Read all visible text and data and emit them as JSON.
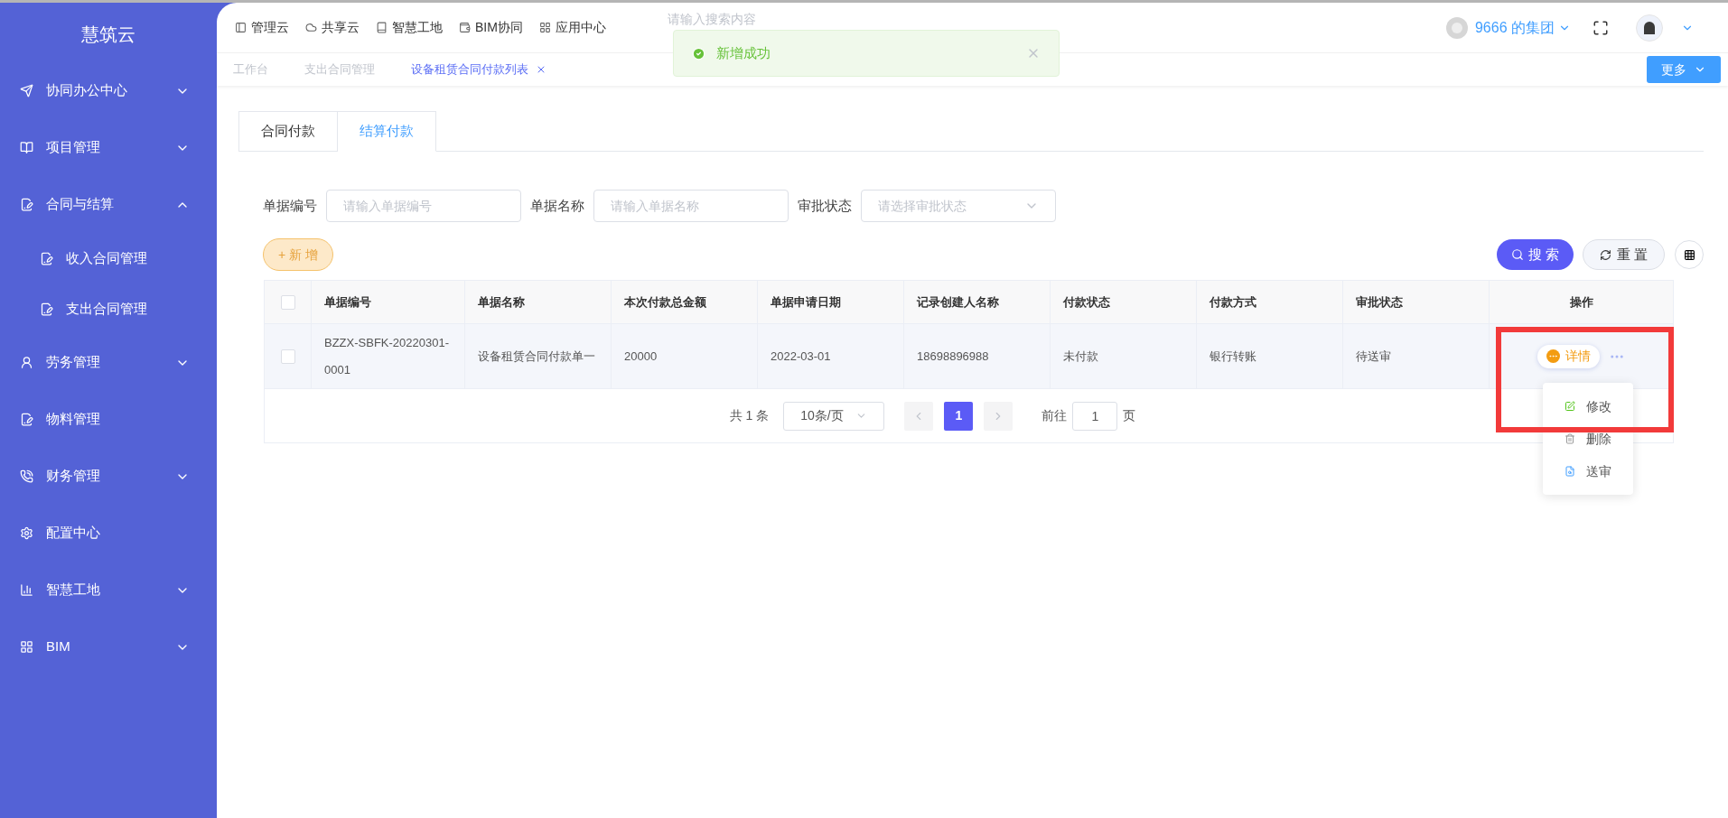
{
  "sidebar": {
    "brand": "慧筑云",
    "items": [
      {
        "label": "协同办公中心",
        "kind": "group",
        "expanded": false
      },
      {
        "label": "项目管理",
        "kind": "group",
        "expanded": false
      },
      {
        "label": "合同与结算",
        "kind": "group",
        "expanded": true,
        "children": [
          {
            "label": "收入合同管理"
          },
          {
            "label": "支出合同管理"
          }
        ]
      },
      {
        "label": "劳务管理",
        "kind": "group",
        "expanded": false
      },
      {
        "label": "物料管理",
        "kind": "link"
      },
      {
        "label": "财务管理",
        "kind": "group",
        "expanded": false
      },
      {
        "label": "配置中心",
        "kind": "link"
      },
      {
        "label": "智慧工地",
        "kind": "group",
        "expanded": false
      },
      {
        "label": "BIM",
        "kind": "group",
        "expanded": false
      }
    ]
  },
  "top_nav": {
    "items": [
      "管理云",
      "共享云",
      "智慧工地",
      "BIM协同",
      "应用中心"
    ],
    "search": {
      "placeholder": "请输入搜索内容"
    },
    "org": "9666 的集团"
  },
  "toast": {
    "message": "新增成功"
  },
  "page_tabs": {
    "items": [
      {
        "label": "工作台",
        "selected": false,
        "closable": false
      },
      {
        "label": "支出合同管理",
        "selected": false,
        "closable": false
      },
      {
        "label": "设备租赁合同付款列表",
        "selected": true,
        "closable": true
      }
    ],
    "more": "更多"
  },
  "content_tabs": [
    {
      "label": "合同付款",
      "selected": false
    },
    {
      "label": "结算付款",
      "selected": true
    }
  ],
  "filters": [
    {
      "label": "单据编号",
      "placeholder": "请输入单据编号",
      "kind": "input"
    },
    {
      "label": "单据名称",
      "placeholder": "请输入单据名称",
      "kind": "input"
    },
    {
      "label": "审批状态",
      "placeholder": "请选择审批状态",
      "kind": "select"
    }
  ],
  "buttons": {
    "add": "+ 新 增",
    "search": "搜 索",
    "reset": "重 置"
  },
  "table": {
    "columns": [
      "单据编号",
      "单据名称",
      "本次付款总金额",
      "单据申请日期",
      "记录创建人名称",
      "付款状态",
      "付款方式",
      "审批状态",
      "操作"
    ],
    "all_checked": false,
    "rows": [
      {
        "checked": false,
        "cells": [
          "BZZX-SBFK-20220301-0001",
          "设备租赁合同付款单一",
          "20000",
          "2022-03-01",
          "18698896988",
          "未付款",
          "银行转账",
          "待送审"
        ],
        "detail": "详情"
      }
    ]
  },
  "action_menu": [
    {
      "label": "修改"
    },
    {
      "label": "删除"
    },
    {
      "label": "送审"
    }
  ],
  "pagination": {
    "total": "共 1 条",
    "page_size": "10条/页",
    "pages": [
      {
        "label": "1",
        "selected": true
      }
    ],
    "goto_label": "前往",
    "goto_value": "1",
    "goto_suffix": "页"
  }
}
